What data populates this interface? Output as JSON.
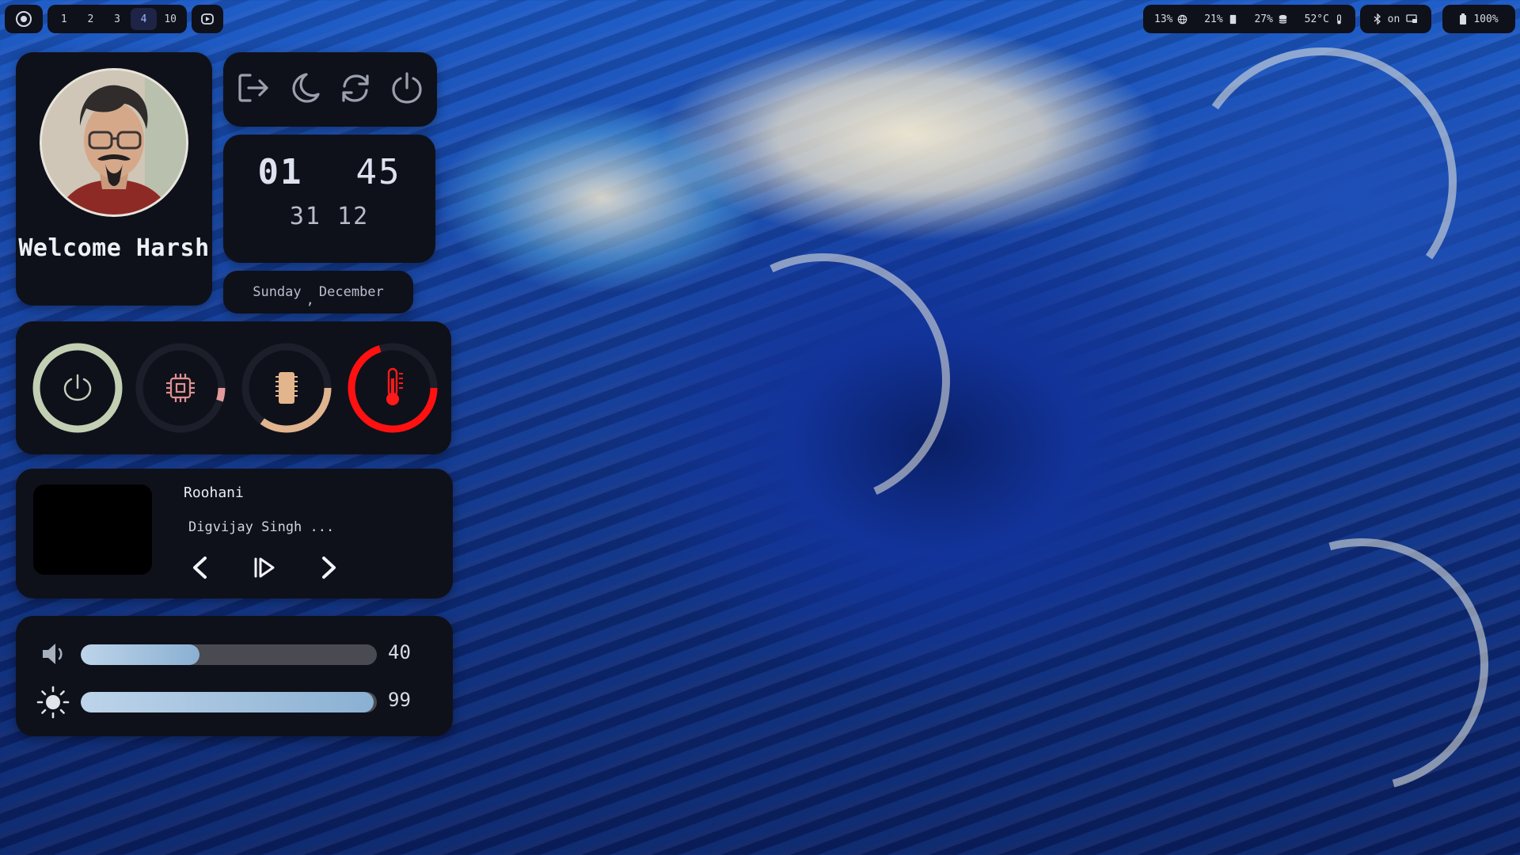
{
  "topbar": {
    "left": {
      "launcher_icon": "circle-dot-icon",
      "workspaces": [
        {
          "label": "1",
          "active": false
        },
        {
          "label": "2",
          "active": false
        },
        {
          "label": "3",
          "active": false
        },
        {
          "label": "4",
          "active": true
        },
        {
          "label": "10",
          "active": false
        }
      ],
      "media_icon": "play-badge-icon"
    },
    "right": {
      "stats": [
        {
          "value": "13%",
          "icon": "globe-icon"
        },
        {
          "value": "21%",
          "icon": "memory-icon"
        },
        {
          "value": "27%",
          "icon": "disk-icon"
        },
        {
          "value": "52°C",
          "icon": "thermometer-icon"
        }
      ],
      "bluetooth": {
        "icon": "bluetooth-icon",
        "status": "on",
        "screen_icon": "monitor-icon"
      },
      "battery": {
        "icon": "battery-icon",
        "value": "100%"
      }
    }
  },
  "profile": {
    "greeting": "Welcome Harsh"
  },
  "power_menu": {
    "items": [
      {
        "name": "logout",
        "icon": "logout-icon"
      },
      {
        "name": "sleep",
        "icon": "moon-icon"
      },
      {
        "name": "reboot",
        "icon": "reboot-icon"
      },
      {
        "name": "shutdown",
        "icon": "power-icon"
      }
    ]
  },
  "clock": {
    "hour": "01",
    "minute": "45",
    "day": "31",
    "month": "12",
    "weekday": "Sunday",
    "separator": ",",
    "month_name": "December"
  },
  "system_gauges": [
    {
      "name": "battery",
      "icon": "power-icon",
      "percent": 100,
      "color": "#c3cfb3"
    },
    {
      "name": "cpu",
      "icon": "cpu-icon",
      "percent": 5,
      "color": "#e39a9a"
    },
    {
      "name": "memory",
      "icon": "memory-icon",
      "percent": 35,
      "color": "#e0b48e"
    },
    {
      "name": "temperature",
      "icon": "thermometer-icon",
      "percent": 70,
      "color": "#ff1111"
    }
  ],
  "music": {
    "title": "Roohani",
    "artist": "Digvijay Singh ...",
    "controls": [
      "previous-icon",
      "play-pause-icon",
      "next-icon"
    ]
  },
  "sliders": {
    "volume": {
      "icon": "speaker-icon",
      "value": "40",
      "level": 0.4
    },
    "brightness": {
      "icon": "sun-icon",
      "value": "99",
      "level": 0.99
    }
  },
  "colors": {
    "panel_bg": "#0f111a",
    "active_workspace": "#9fb4ff",
    "slider_fill": "#a9c6e2",
    "slider_track": "#4a4b52"
  }
}
